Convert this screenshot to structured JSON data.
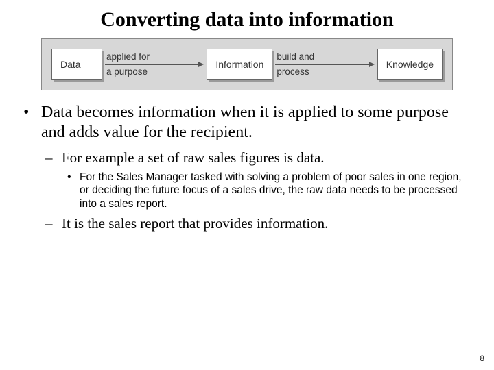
{
  "title": "Converting data into information",
  "diagram": {
    "node1": "Data",
    "arrow1_top": "applied for",
    "arrow1_bottom": "a purpose",
    "node2": "Information",
    "arrow2_top": "build and",
    "arrow2_bottom": "process",
    "node3": "Knowledge"
  },
  "bullets": {
    "l1_1": "Data becomes information when it is applied to some purpose and adds value for the recipient.",
    "l2_1": "For example a set of raw sales figures is data.",
    "l3_1": "For the Sales Manager tasked with solving a problem of poor sales in one region, or deciding the future focus of a sales drive, the raw data needs to be processed into a sales report.",
    "l2_2": "It is the sales report that provides information."
  },
  "page_number": "8"
}
